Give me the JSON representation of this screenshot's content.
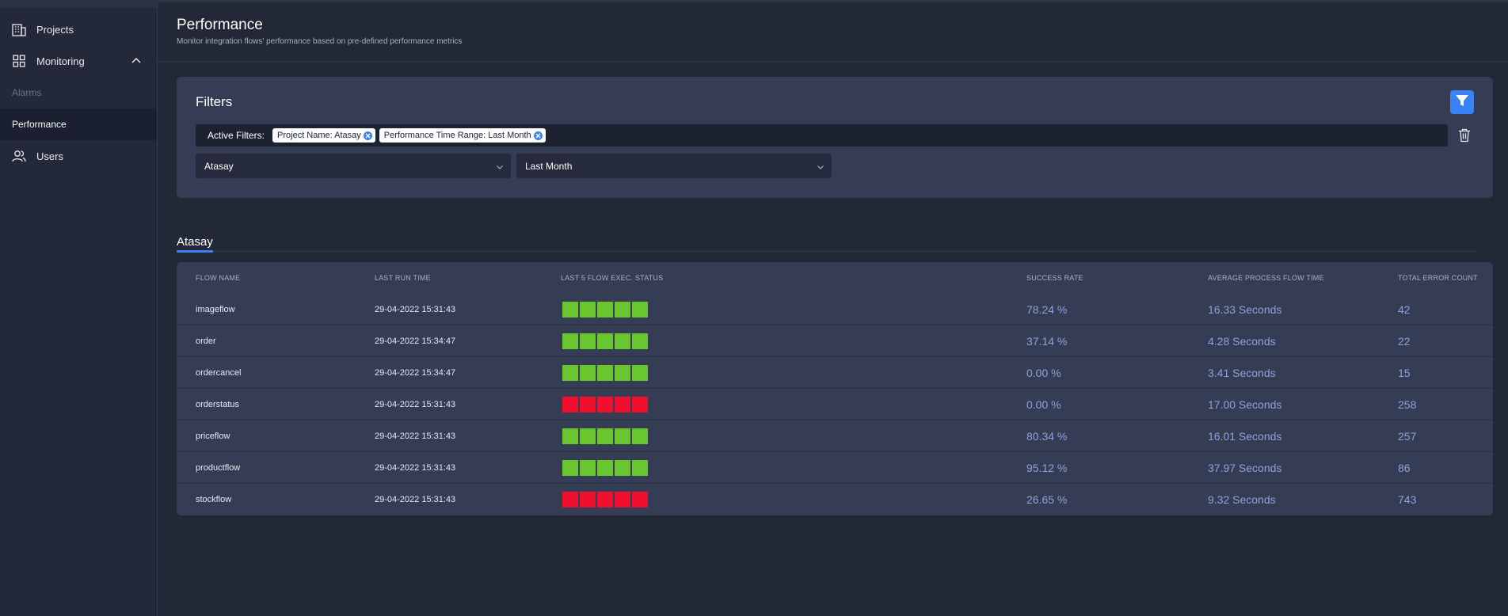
{
  "sidebar": {
    "items": [
      {
        "label": "Projects",
        "icon": "building-icon"
      },
      {
        "label": "Monitoring",
        "icon": "grid-icon",
        "expanded": true
      },
      {
        "label": "Alarms"
      },
      {
        "label": "Performance",
        "active": true
      },
      {
        "label": "Users",
        "icon": "users-icon"
      }
    ]
  },
  "header": {
    "title": "Performance",
    "subtitle": "Monitor integration flows' performance based on pre-defined performance metrics"
  },
  "filters": {
    "title": "Filters",
    "active_label": "Active Filters:",
    "chips": [
      "Project Name: Atasay",
      "Performance Time Range: Last Month"
    ],
    "project_select": "Atasay",
    "range_select": "Last Month"
  },
  "section": {
    "title": "Atasay"
  },
  "table": {
    "headers": [
      "FLOW NAME",
      "LAST RUN TIME",
      "LAST 5 FLOW EXEC. STATUS",
      "SUCCESS RATE",
      "AVERAGE PROCESS FLOW TIME",
      "TOTAL ERROR COUNT"
    ],
    "rows": [
      {
        "name": "imageflow",
        "last_run": "29-04-2022 15:31:43",
        "status": [
          "success",
          "success",
          "success",
          "success",
          "success"
        ],
        "success_rate": "78.24 %",
        "avg_time": "16.33 Seconds",
        "errors": "42"
      },
      {
        "name": "order",
        "last_run": "29-04-2022 15:34:47",
        "status": [
          "success",
          "success",
          "success",
          "success",
          "success"
        ],
        "success_rate": "37.14 %",
        "avg_time": "4.28 Seconds",
        "errors": "22"
      },
      {
        "name": "ordercancel",
        "last_run": "29-04-2022 15:34:47",
        "status": [
          "success",
          "success",
          "success",
          "success",
          "success"
        ],
        "success_rate": "0.00 %",
        "avg_time": "3.41 Seconds",
        "errors": "15"
      },
      {
        "name": "orderstatus",
        "last_run": "29-04-2022 15:31:43",
        "status": [
          "fail",
          "fail",
          "fail",
          "fail",
          "fail"
        ],
        "success_rate": "0.00 %",
        "avg_time": "17.00 Seconds",
        "errors": "258"
      },
      {
        "name": "priceflow",
        "last_run": "29-04-2022 15:31:43",
        "status": [
          "success",
          "success",
          "success",
          "success",
          "success"
        ],
        "success_rate": "80.34 %",
        "avg_time": "16.01 Seconds",
        "errors": "257"
      },
      {
        "name": "productflow",
        "last_run": "29-04-2022 15:31:43",
        "status": [
          "success",
          "success",
          "success",
          "success",
          "success"
        ],
        "success_rate": "95.12 %",
        "avg_time": "37.97 Seconds",
        "errors": "86"
      },
      {
        "name": "stockflow",
        "last_run": "29-04-2022 15:31:43",
        "status": [
          "fail",
          "fail",
          "fail",
          "fail",
          "fail"
        ],
        "success_rate": "26.65 %",
        "avg_time": "9.32 Seconds",
        "errors": "743"
      }
    ]
  },
  "colors": {
    "success": "#6ac62f",
    "fail": "#f0102e",
    "accent": "#3b82f6",
    "metric": "#8ea1d9"
  }
}
